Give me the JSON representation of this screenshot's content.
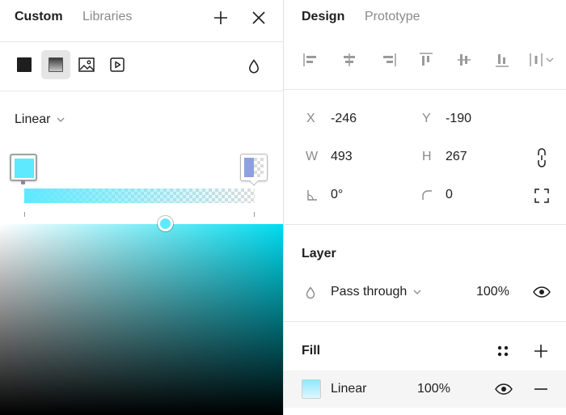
{
  "picker": {
    "tabs": [
      "Custom",
      "Libraries"
    ],
    "fill_types": [
      "Solid",
      "Gradient",
      "Image",
      "Video"
    ],
    "gradient_type": "Linear",
    "stops": [
      {
        "color": "#5ee9ff",
        "position": 0
      },
      {
        "color": "#8fa0e0",
        "position": 1
      }
    ],
    "field_hue": "#00dcf0",
    "field_handle_color": "#5ee9ff"
  },
  "design": {
    "tabs": [
      "Design",
      "Prototype"
    ],
    "x_label": "X",
    "x_value": "-246",
    "y_label": "Y",
    "y_value": "-190",
    "w_label": "W",
    "w_value": "493",
    "h_label": "H",
    "h_value": "267",
    "rotation_value": "0°",
    "radius_value": "0",
    "layer": {
      "title": "Layer",
      "blend_mode": "Pass through",
      "opacity": "100%"
    },
    "fill": {
      "title": "Fill",
      "type": "Linear",
      "opacity": "100%"
    }
  }
}
